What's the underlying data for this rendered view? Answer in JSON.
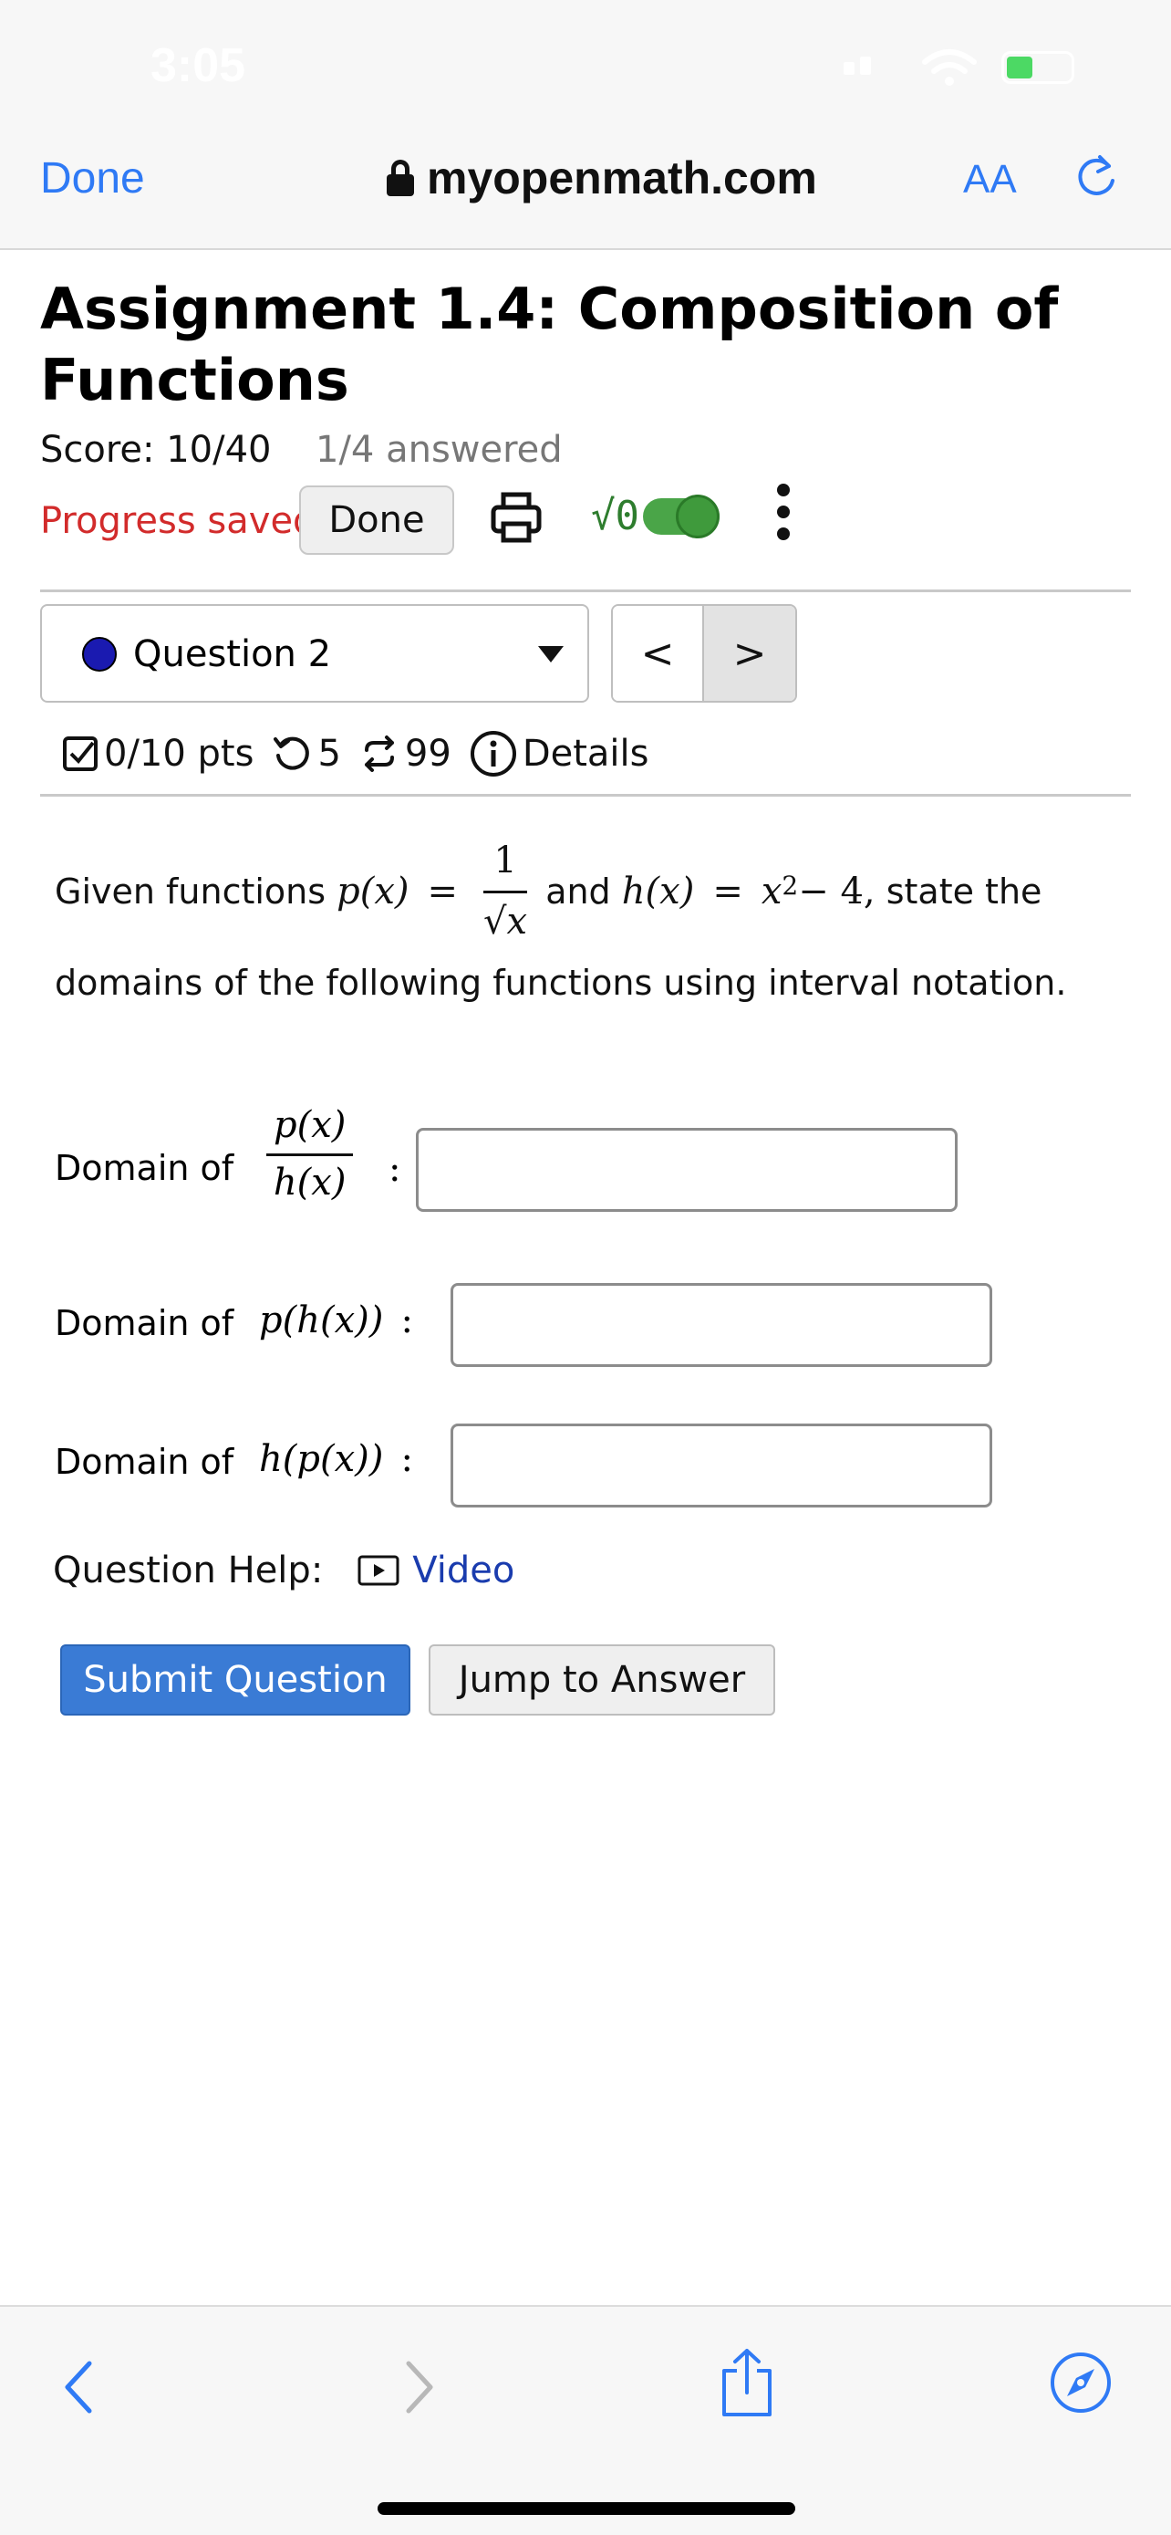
{
  "status_bar": {
    "time": "3:05"
  },
  "browser": {
    "done_label": "Done",
    "url": "myopenmath.com",
    "aa_label": "AA",
    "icons": [
      "lock-icon",
      "reload-icon",
      "back-icon",
      "forward-icon",
      "share-icon",
      "compass-icon"
    ]
  },
  "assignment": {
    "title": "Assignment 1.4: Composition of Functions",
    "score": "Score: 10/40",
    "answered": "1/4 answered",
    "progress": "Progress saved",
    "done_button": "Done",
    "sqrt_label": "√0"
  },
  "question_nav": {
    "selected": "Question 2",
    "prev": "<",
    "next": ">"
  },
  "question_meta": {
    "points": "0/10 pts",
    "retries": "5",
    "attempts": "99",
    "details": "Details"
  },
  "question": {
    "intro": "Given functions",
    "p_def_lhs": "p(x)",
    "eq": "=",
    "p_num": "1",
    "p_den": "√x",
    "and": "and",
    "h_def": "h(x)",
    "h_rhs": "x",
    "h_exp": "2",
    "h_tail": " − 4,",
    "state": "state the",
    "line2": "domains of the following functions using interval notation."
  },
  "answers": {
    "label": "Domain of",
    "row1_num": "p(x)",
    "row1_den": "h(x)",
    "row2_expr": "p(h(x))",
    "row3_expr": "h(p(x))",
    "colon": ":"
  },
  "help": {
    "label": "Question Help:",
    "video": "Video"
  },
  "buttons": {
    "submit": "Submit Question",
    "jump": "Jump to Answer"
  },
  "colors": {
    "link_blue": "#2f7af5",
    "progress_red": "#d22b2b",
    "submit_blue": "#3a7bd5",
    "toggle_green": "#4aa548"
  }
}
